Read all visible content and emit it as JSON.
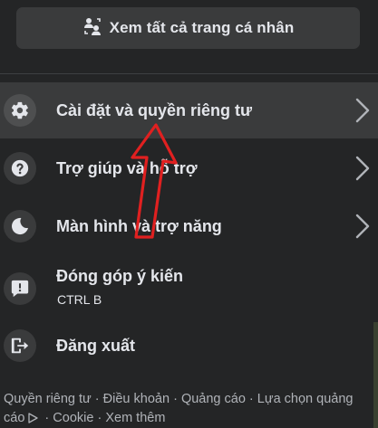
{
  "profile_button": {
    "label": "Xem tất cả trang cá nhân",
    "icon": "switch-profiles-icon"
  },
  "menu": [
    {
      "label": "Cài đặt và quyền riêng tư",
      "icon": "gear-icon",
      "has_chevron": true,
      "active": true
    },
    {
      "label": "Trợ giúp và hỗ trợ",
      "icon": "question-icon",
      "has_chevron": true
    },
    {
      "label": "Màn hình và trợ năng",
      "icon": "moon-icon",
      "has_chevron": true
    },
    {
      "label": "Đóng góp ý kiến",
      "sublabel": "CTRL B",
      "icon": "feedback-icon",
      "has_chevron": false
    },
    {
      "label": "Đăng xuất",
      "icon": "logout-icon",
      "has_chevron": false
    }
  ],
  "footer": {
    "links": [
      "Quyền riêng tư",
      "Điều khoản",
      "Quảng cáo",
      "Lựa chọn quảng cáo",
      "Cookie",
      "Xem thêm"
    ],
    "separator": "·"
  },
  "colors": {
    "background": "#242526",
    "button": "#3a3b3c",
    "text": "#e4e6eb",
    "secondary_text": "#b0b3b8",
    "annotation": "#e02020"
  }
}
